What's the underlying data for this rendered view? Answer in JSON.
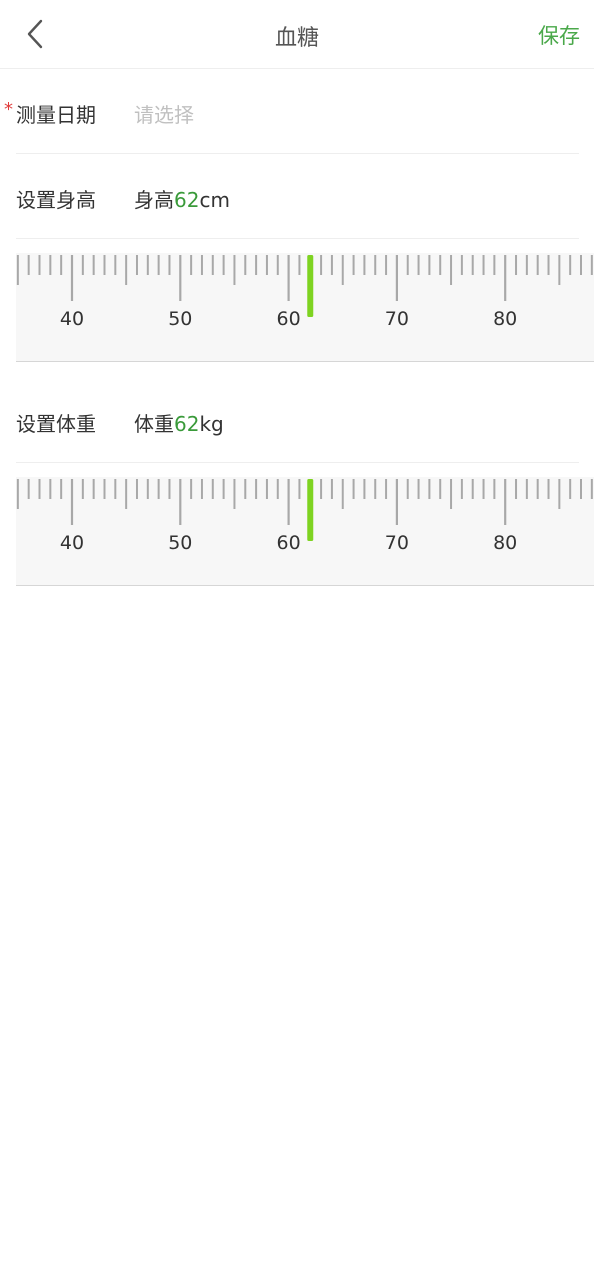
{
  "header": {
    "title": "血糖",
    "save_label": "保存"
  },
  "date_row": {
    "required_mark": "*",
    "label": "测量日期",
    "placeholder": "请选择"
  },
  "height_row": {
    "label": "设置身高",
    "prefix": "身高",
    "value": "62",
    "unit": "cm"
  },
  "weight_row": {
    "label": "设置体重",
    "prefix": "体重",
    "value": "62",
    "unit": "kg"
  },
  "ruler_height": {
    "major_labels": [
      "40",
      "50",
      "60",
      "70",
      "80"
    ],
    "start_value": 35,
    "end_value": 88,
    "selected_value": 62,
    "indicator_color": "#7ed321"
  },
  "ruler_weight": {
    "major_labels": [
      "40",
      "50",
      "60",
      "70",
      "80"
    ],
    "start_value": 35,
    "end_value": 88,
    "selected_value": 62,
    "indicator_color": "#7ed321"
  },
  "icons": {
    "back": "chevron-left-icon"
  }
}
